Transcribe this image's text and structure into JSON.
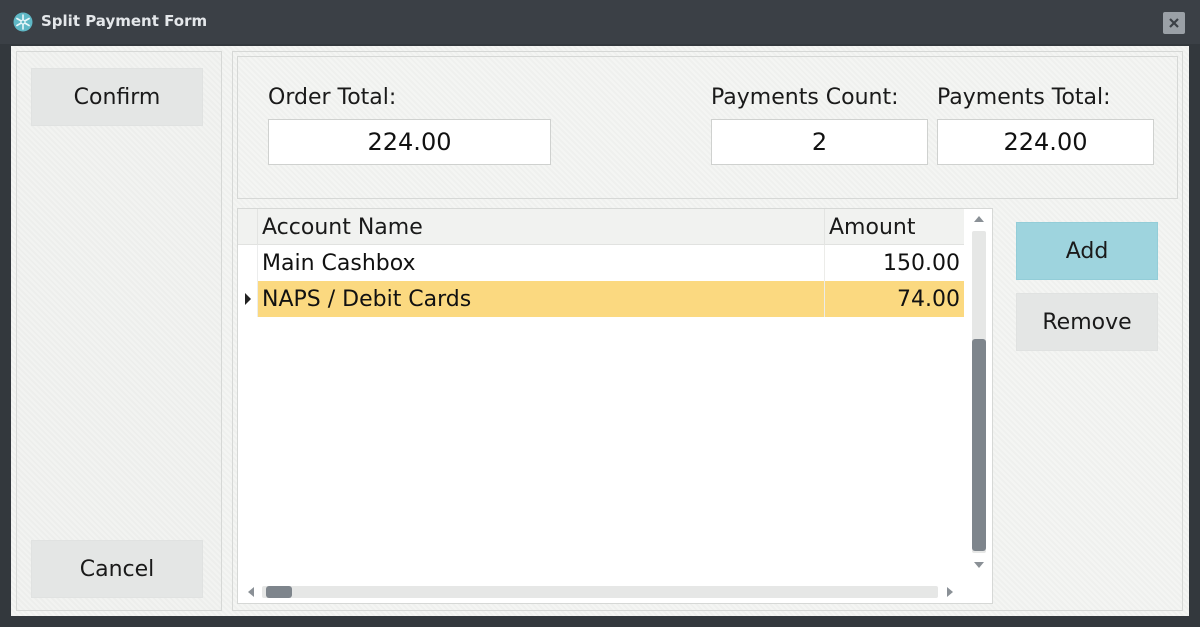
{
  "window": {
    "title": "Split Payment Form",
    "icon": "snowflake-app-icon",
    "close_icon": "close-icon"
  },
  "sidebar": {
    "confirm_label": "Confirm",
    "cancel_label": "Cancel"
  },
  "totals": {
    "order_total_label": "Order Total:",
    "order_total_value": "224.00",
    "payments_count_label": "Payments Count:",
    "payments_count_value": "2",
    "payments_total_label": "Payments Total:",
    "payments_total_value": "224.00"
  },
  "grid": {
    "columns": [
      "Account Name",
      "Amount"
    ],
    "rows": [
      {
        "account_name": "Main Cashbox",
        "amount": "150.00",
        "selected": false
      },
      {
        "account_name": "NAPS / Debit Cards",
        "amount": "74.00",
        "selected": true
      }
    ]
  },
  "actions": {
    "add_label": "Add",
    "remove_label": "Remove"
  },
  "colors": {
    "titlebar": "#3b4046",
    "selected_row": "#fbd980",
    "add_button": "#9ed4de",
    "scroll_thumb": "#7e858c"
  }
}
